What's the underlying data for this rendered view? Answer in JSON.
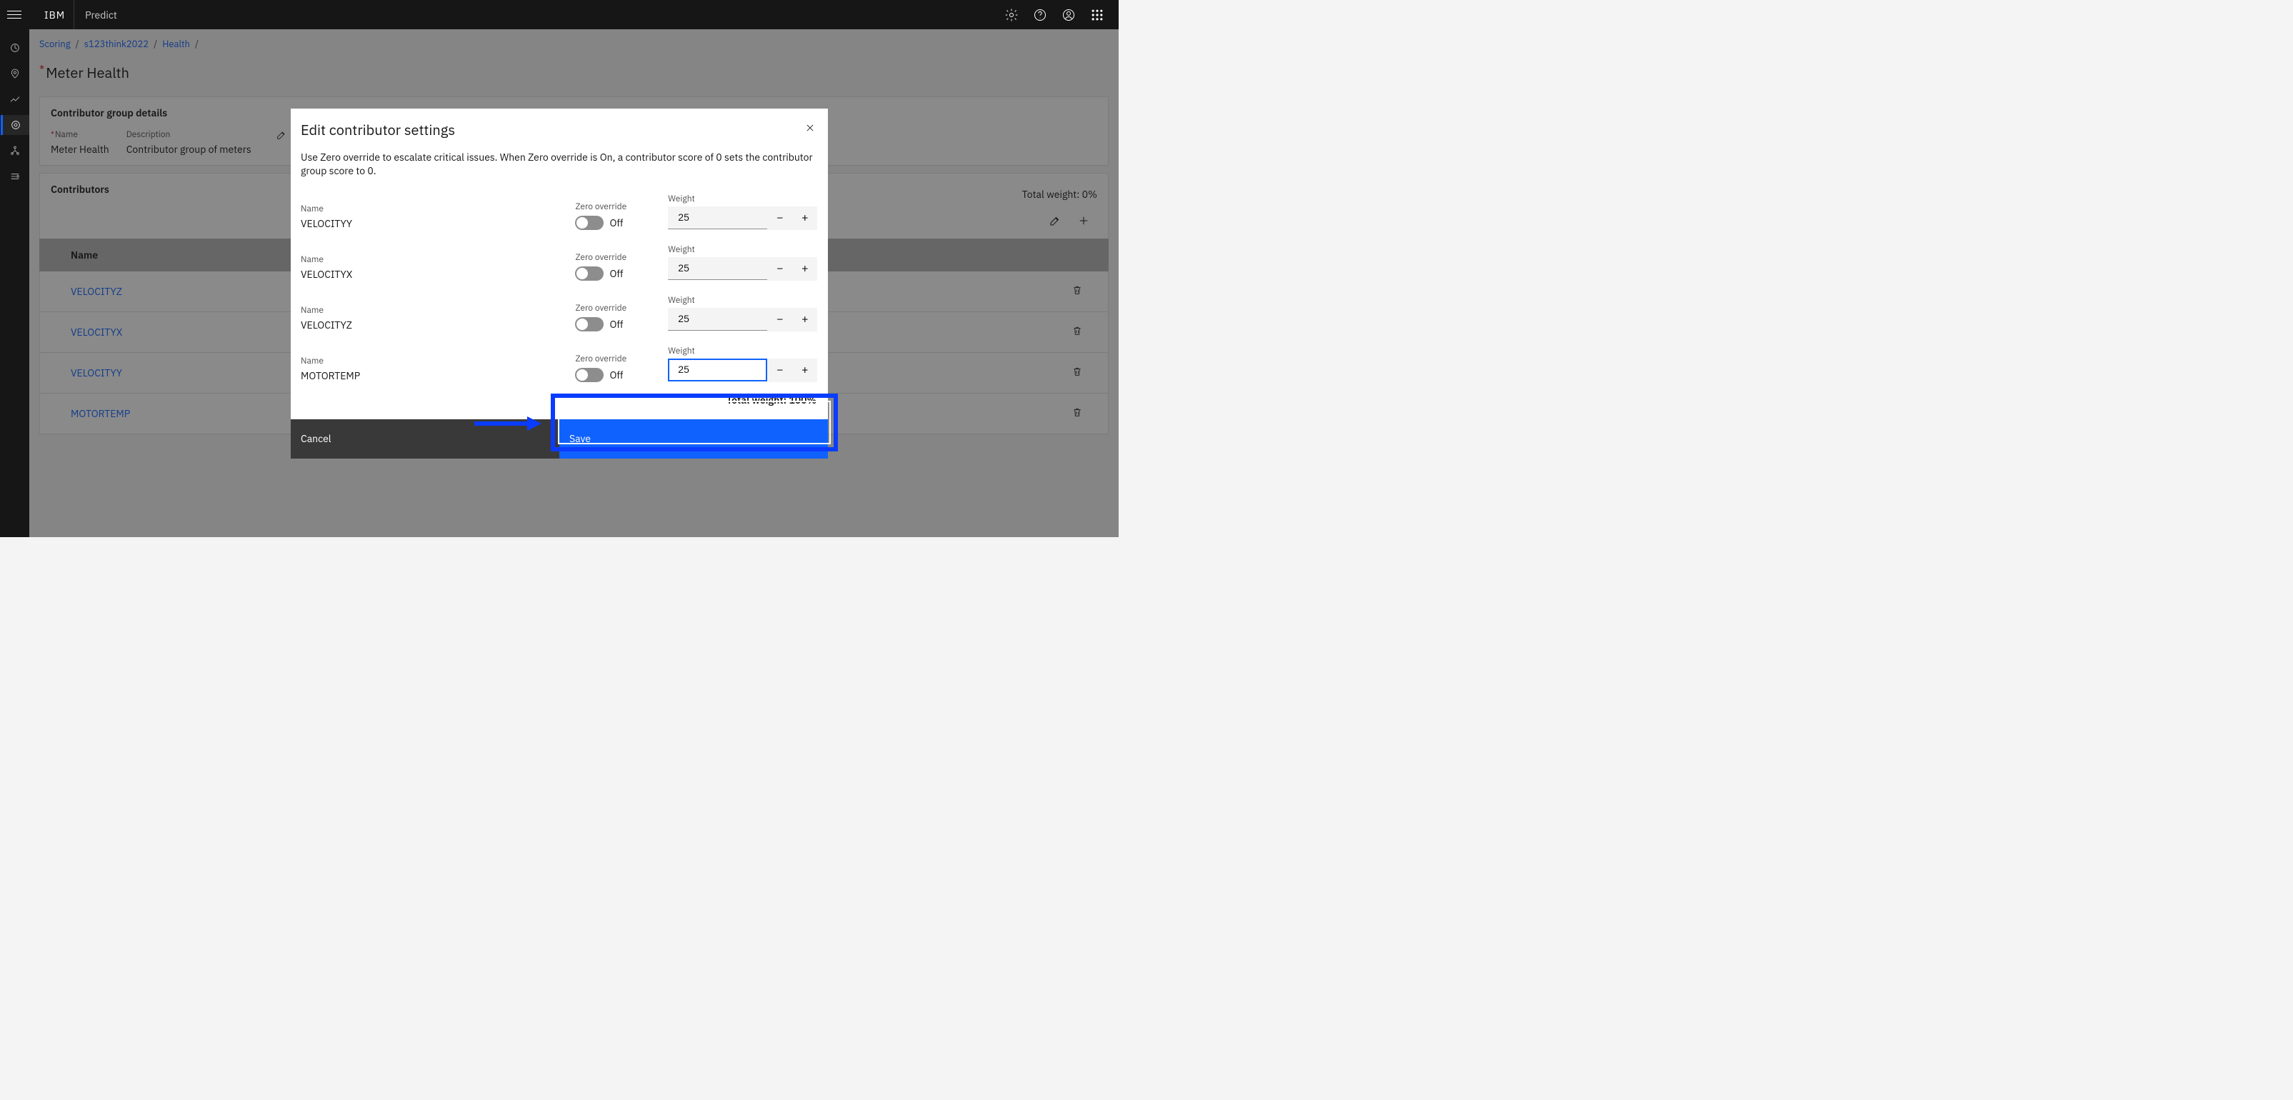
{
  "header": {
    "brand": "IBM",
    "app": "Predict"
  },
  "breadcrumb": {
    "items": [
      "Scoring",
      "s123think2022",
      "Health"
    ]
  },
  "page_title": "Meter Health",
  "details_panel": {
    "title": "Contributor group details",
    "name_label": "Name",
    "name_value": "Meter Health",
    "desc_label": "Description",
    "desc_value": "Contributor group of meters"
  },
  "contributors_panel": {
    "title": "Contributors",
    "total_weight_label": "Total weight: 0%",
    "column_name": "Name",
    "rows": [
      {
        "name": "VELOCITYZ"
      },
      {
        "name": "VELOCITYX"
      },
      {
        "name": "VELOCITYY"
      },
      {
        "name": "MOTORTEMP"
      }
    ]
  },
  "modal": {
    "title": "Edit contributor settings",
    "description": "Use Zero override to escalate critical issues. When Zero override is On, a contributor score of 0 sets the contributor group score to 0.",
    "name_label": "Name",
    "zero_label": "Zero override",
    "zero_off": "Off",
    "weight_label": "Weight",
    "rows": [
      {
        "name": "VELOCITYY",
        "weight": "25"
      },
      {
        "name": "VELOCITYX",
        "weight": "25"
      },
      {
        "name": "VELOCITYZ",
        "weight": "25"
      },
      {
        "name": "MOTORTEMP",
        "weight": "25"
      }
    ],
    "total_weight": "Total weight: 100%",
    "cancel": "Cancel",
    "save": "Save"
  }
}
